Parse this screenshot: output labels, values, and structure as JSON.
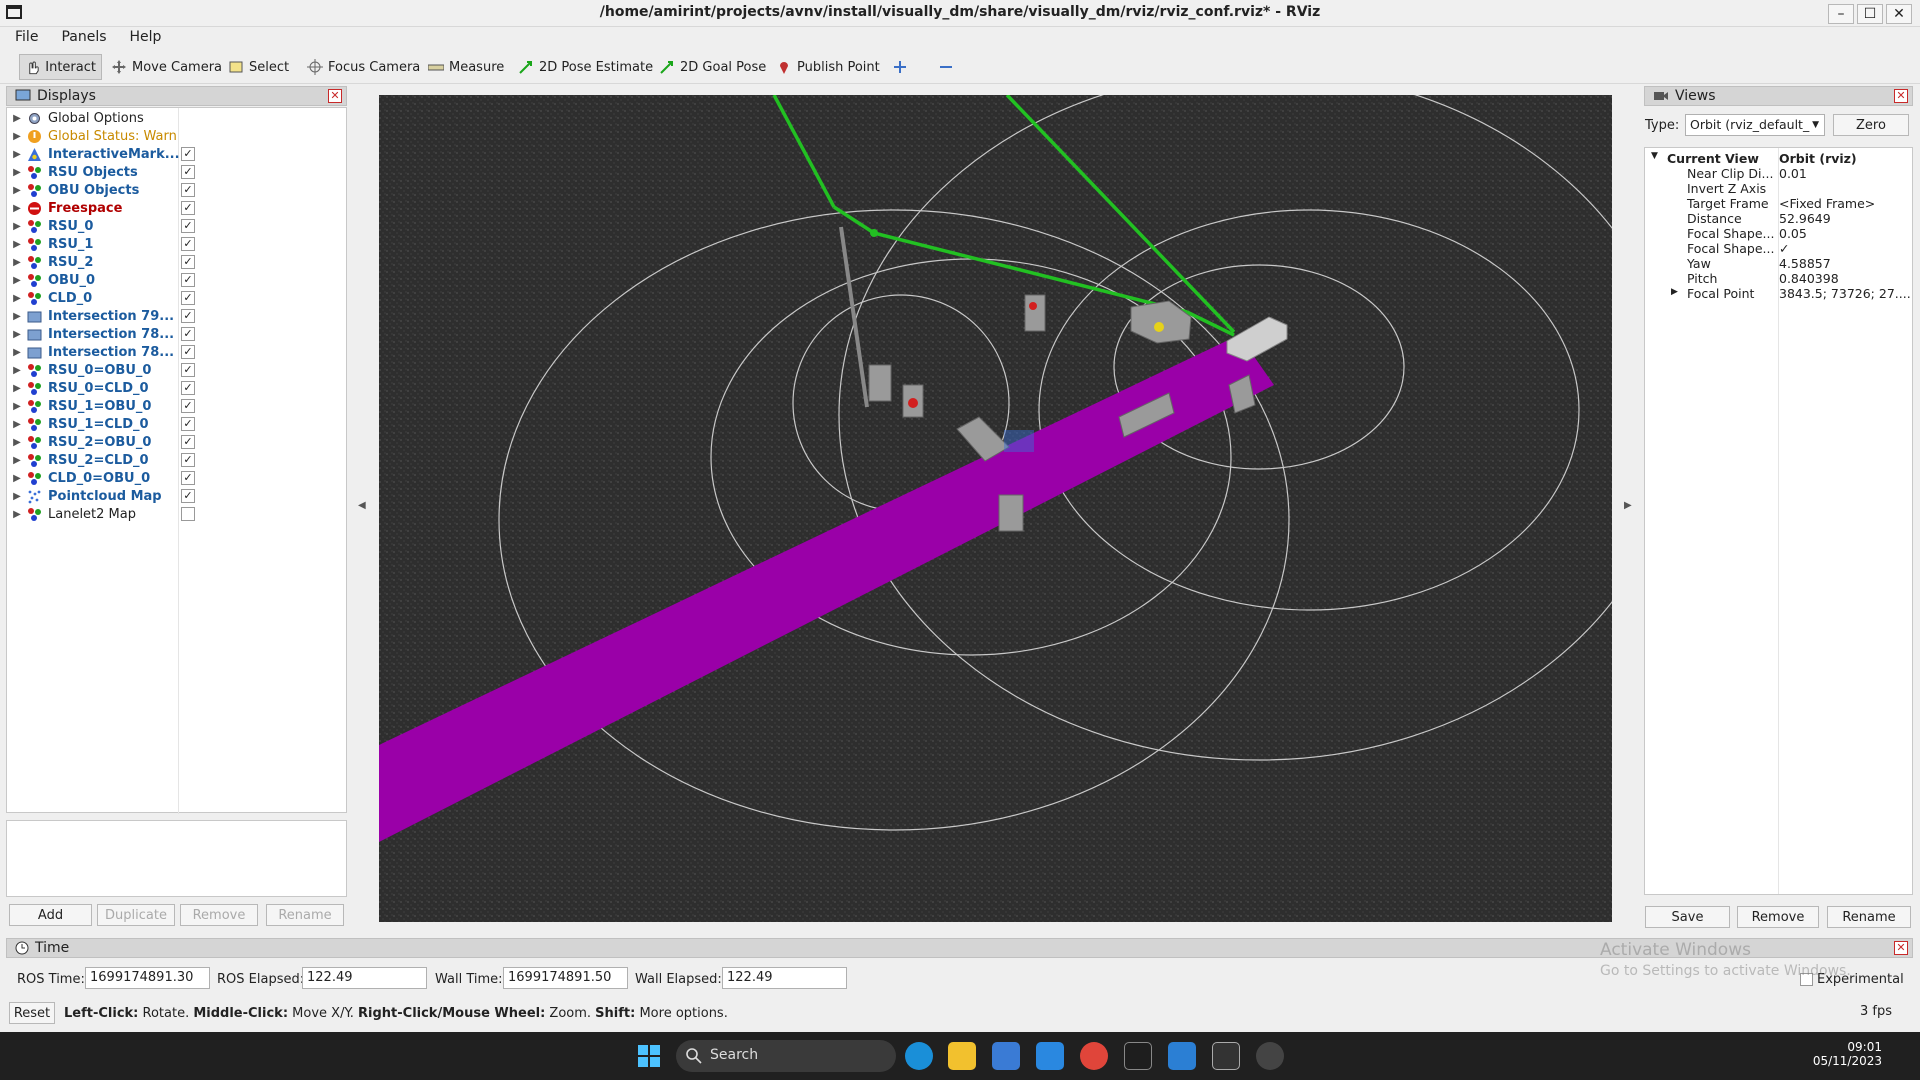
{
  "window": {
    "title": "/home/amirint/projects/avnv/install/visually_dm/share/visually_dm/rviz/rviz_conf.rviz* - RViz"
  },
  "menu": [
    "File",
    "Panels",
    "Help"
  ],
  "toolbar": {
    "interact": "Interact",
    "move_camera": "Move Camera",
    "select": "Select",
    "focus_camera": "Focus Camera",
    "measure": "Measure",
    "pose_estimate": "2D Pose Estimate",
    "goal_pose": "2D Goal Pose",
    "publish_point": "Publish Point"
  },
  "displays": {
    "title": "Displays",
    "items": [
      {
        "label": "Global Options",
        "style": "plain",
        "checked": null,
        "icon": "gear-icon"
      },
      {
        "label": "Global Status: Warn",
        "style": "warn",
        "checked": null,
        "icon": "warning-icon"
      },
      {
        "label": "InteractiveMark...",
        "style": "bold",
        "checked": true,
        "icon": "interactive-marker-icon"
      },
      {
        "label": "RSU Objects",
        "style": "bold",
        "checked": true,
        "icon": "marker-array-icon"
      },
      {
        "label": "OBU Objects",
        "style": "bold",
        "checked": true,
        "icon": "marker-array-icon"
      },
      {
        "label": "Freespace",
        "style": "err",
        "checked": true,
        "icon": "error-icon"
      },
      {
        "label": "RSU_0",
        "style": "bold",
        "checked": true,
        "icon": "marker-array-icon"
      },
      {
        "label": "RSU_1",
        "style": "bold",
        "checked": true,
        "icon": "marker-array-icon"
      },
      {
        "label": "RSU_2",
        "style": "bold",
        "checked": true,
        "icon": "marker-array-icon"
      },
      {
        "label": "OBU_0",
        "style": "bold",
        "checked": true,
        "icon": "marker-array-icon"
      },
      {
        "label": "CLD_0",
        "style": "bold",
        "checked": true,
        "icon": "marker-array-icon"
      },
      {
        "label": "Intersection 79...",
        "style": "bold",
        "checked": true,
        "icon": "folder-icon"
      },
      {
        "label": "Intersection 78...",
        "style": "bold",
        "checked": true,
        "icon": "folder-icon"
      },
      {
        "label": "Intersection 78...",
        "style": "bold",
        "checked": true,
        "icon": "folder-icon"
      },
      {
        "label": "RSU_0=OBU_0",
        "style": "bold",
        "checked": true,
        "icon": "marker-array-icon"
      },
      {
        "label": "RSU_0=CLD_0",
        "style": "bold",
        "checked": true,
        "icon": "marker-array-icon"
      },
      {
        "label": "RSU_1=OBU_0",
        "style": "bold",
        "checked": true,
        "icon": "marker-array-icon"
      },
      {
        "label": "RSU_1=CLD_0",
        "style": "bold",
        "checked": true,
        "icon": "marker-array-icon"
      },
      {
        "label": "RSU_2=OBU_0",
        "style": "bold",
        "checked": true,
        "icon": "marker-array-icon"
      },
      {
        "label": "RSU_2=CLD_0",
        "style": "bold",
        "checked": true,
        "icon": "marker-array-icon"
      },
      {
        "label": "CLD_0=OBU_0",
        "style": "bold",
        "checked": true,
        "icon": "marker-array-icon"
      },
      {
        "label": "Pointcloud Map",
        "style": "bold",
        "checked": true,
        "icon": "pointcloud-icon"
      },
      {
        "label": "Lanelet2 Map",
        "style": "plain",
        "checked": false,
        "icon": "marker-array-icon"
      }
    ],
    "buttons": {
      "add": "Add",
      "duplicate": "Duplicate",
      "remove": "Remove",
      "rename": "Rename"
    }
  },
  "views": {
    "title": "Views",
    "type_label": "Type:",
    "type_value": "Orbit (rviz_default_",
    "zero": "Zero",
    "current_view": {
      "key": "Current View",
      "value": "Orbit (rviz)"
    },
    "props": [
      {
        "k": "Near Clip Di...",
        "v": "0.01"
      },
      {
        "k": "Invert Z Axis",
        "v": ""
      },
      {
        "k": "Target Frame",
        "v": "<Fixed Frame>"
      },
      {
        "k": "Distance",
        "v": "52.9649"
      },
      {
        "k": "Focal Shape...",
        "v": "0.05"
      },
      {
        "k": "Focal Shape...",
        "v": "✓"
      },
      {
        "k": "Yaw",
        "v": "4.58857"
      },
      {
        "k": "Pitch",
        "v": "0.840398"
      },
      {
        "k": "Focal Point",
        "v": "3843.5; 73726; 27...."
      }
    ],
    "buttons": {
      "save": "Save",
      "remove": "Remove",
      "rename": "Rename"
    }
  },
  "time": {
    "title": "Time",
    "ros_time_label": "ROS Time:",
    "ros_time": "1699174891.30",
    "ros_elapsed_label": "ROS Elapsed:",
    "ros_elapsed": "122.49",
    "wall_time_label": "Wall Time:",
    "wall_time": "1699174891.50",
    "wall_elapsed_label": "Wall Elapsed:",
    "wall_elapsed": "122.49",
    "experimental": "Experimental"
  },
  "status": {
    "reset": "Reset",
    "hint_b1": "Left-Click:",
    "hint_t1": " Rotate. ",
    "hint_b2": "Middle-Click:",
    "hint_t2": " Move X/Y. ",
    "hint_b3": "Right-Click/Mouse Wheel:",
    "hint_t3": " Zoom. ",
    "hint_b4": "Shift:",
    "hint_t4": " More options.",
    "fps": "3 fps"
  },
  "watermark": {
    "line1": "Activate Windows",
    "line2": "Go to Settings to activate Windows."
  },
  "taskbar": {
    "search": "Search",
    "time": "09:01",
    "date": "05/11/2023"
  },
  "colors": {
    "freespace": "#9a00a8",
    "link": "#22c022",
    "ground": "#2e2e2e"
  }
}
